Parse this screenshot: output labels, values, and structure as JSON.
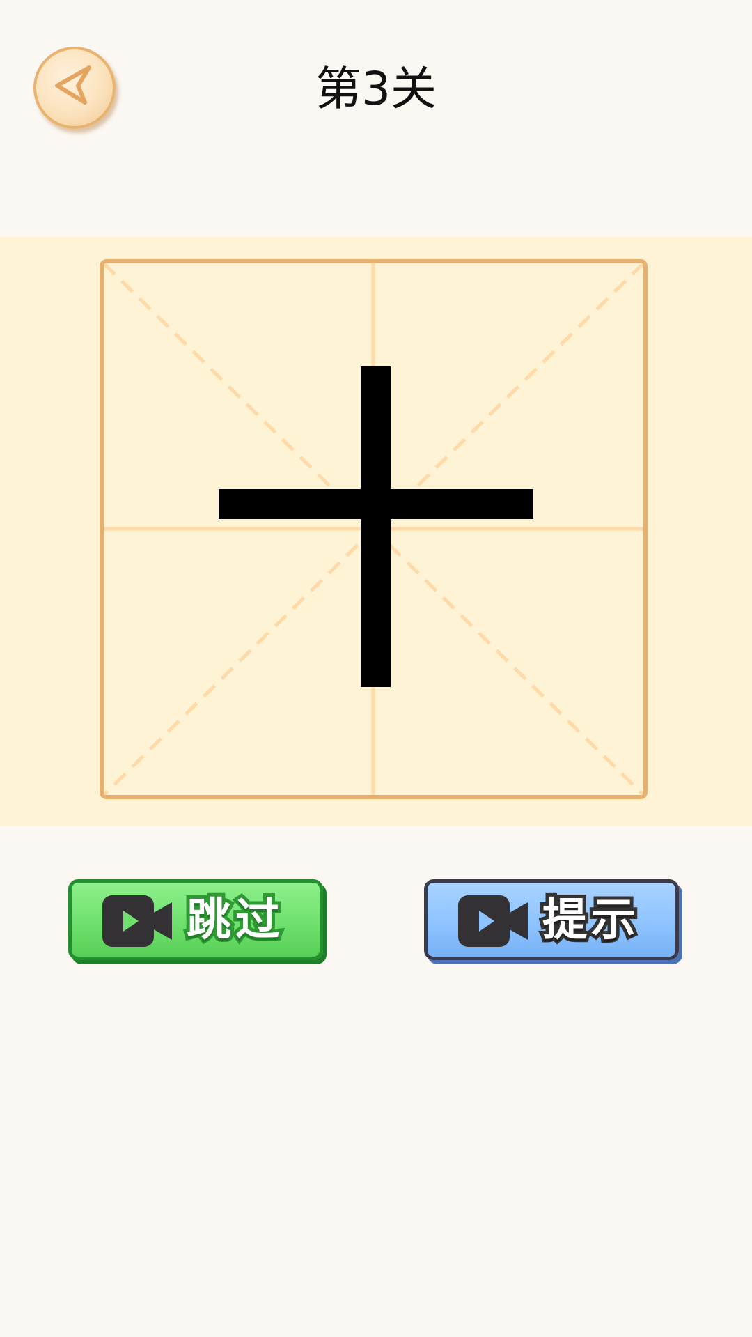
{
  "header": {
    "level_title": "第3关",
    "back_icon": "back-arrow-icon"
  },
  "practice": {
    "character": "十",
    "grid_style": "mi-zi-ge",
    "colors": {
      "border": "#e8b06d",
      "guides": "#ffd9a8",
      "background": "#fff3d6",
      "strokes": "#000000"
    }
  },
  "buttons": {
    "skip": {
      "label": "跳过",
      "icon": "video-camera-icon",
      "color": "#6fe06d"
    },
    "hint": {
      "label": "提示",
      "icon": "video-camera-icon",
      "color": "#8ec3ff"
    }
  }
}
